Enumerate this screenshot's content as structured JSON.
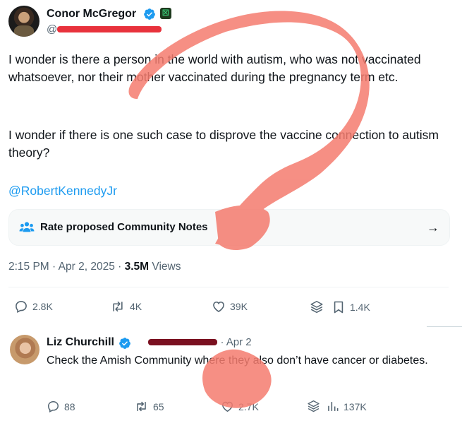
{
  "tweet": {
    "author_name": "Conor McGregor",
    "handle_prefix": "@",
    "text_p1": "I wonder is there a person in the world with autism, who was not vaccinated whatsoever, nor their mother vaccinated during the pregnancy term etc.",
    "text_p2": "I wonder if there is one such case to disprove the vaccine connection to autism theory?",
    "mention": "@RobertKennedyJr",
    "notes_label": "Rate proposed Community Notes",
    "time": "2:15 PM",
    "date": "Apr 2, 2025",
    "views_count": "3.5M",
    "views_label": "Views",
    "replies": "2.8K",
    "reposts": "4K",
    "likes": "39K",
    "bookmarks": "1.4K"
  },
  "reply": {
    "author_name": "Liz Churchill",
    "date": "Apr 2",
    "text": "Check the Amish Community where they also don’t have cancer or diabetes.",
    "replies": "88",
    "reposts": "65",
    "likes": "2.7K",
    "views": "137K"
  },
  "colors": {
    "link_blue": "#1d9bf0",
    "verified_blue": "#1d9bf0",
    "redaction_red": "#e8323c",
    "redaction_maroon": "#7a1020",
    "overlay_salmon": "#f47b6e"
  },
  "icons": [
    "verified-badge-icon",
    "community-notes-icon",
    "arrow-right-icon",
    "reply-icon",
    "repost-icon",
    "like-icon",
    "grok-icon",
    "bookmark-icon",
    "views-icon"
  ]
}
